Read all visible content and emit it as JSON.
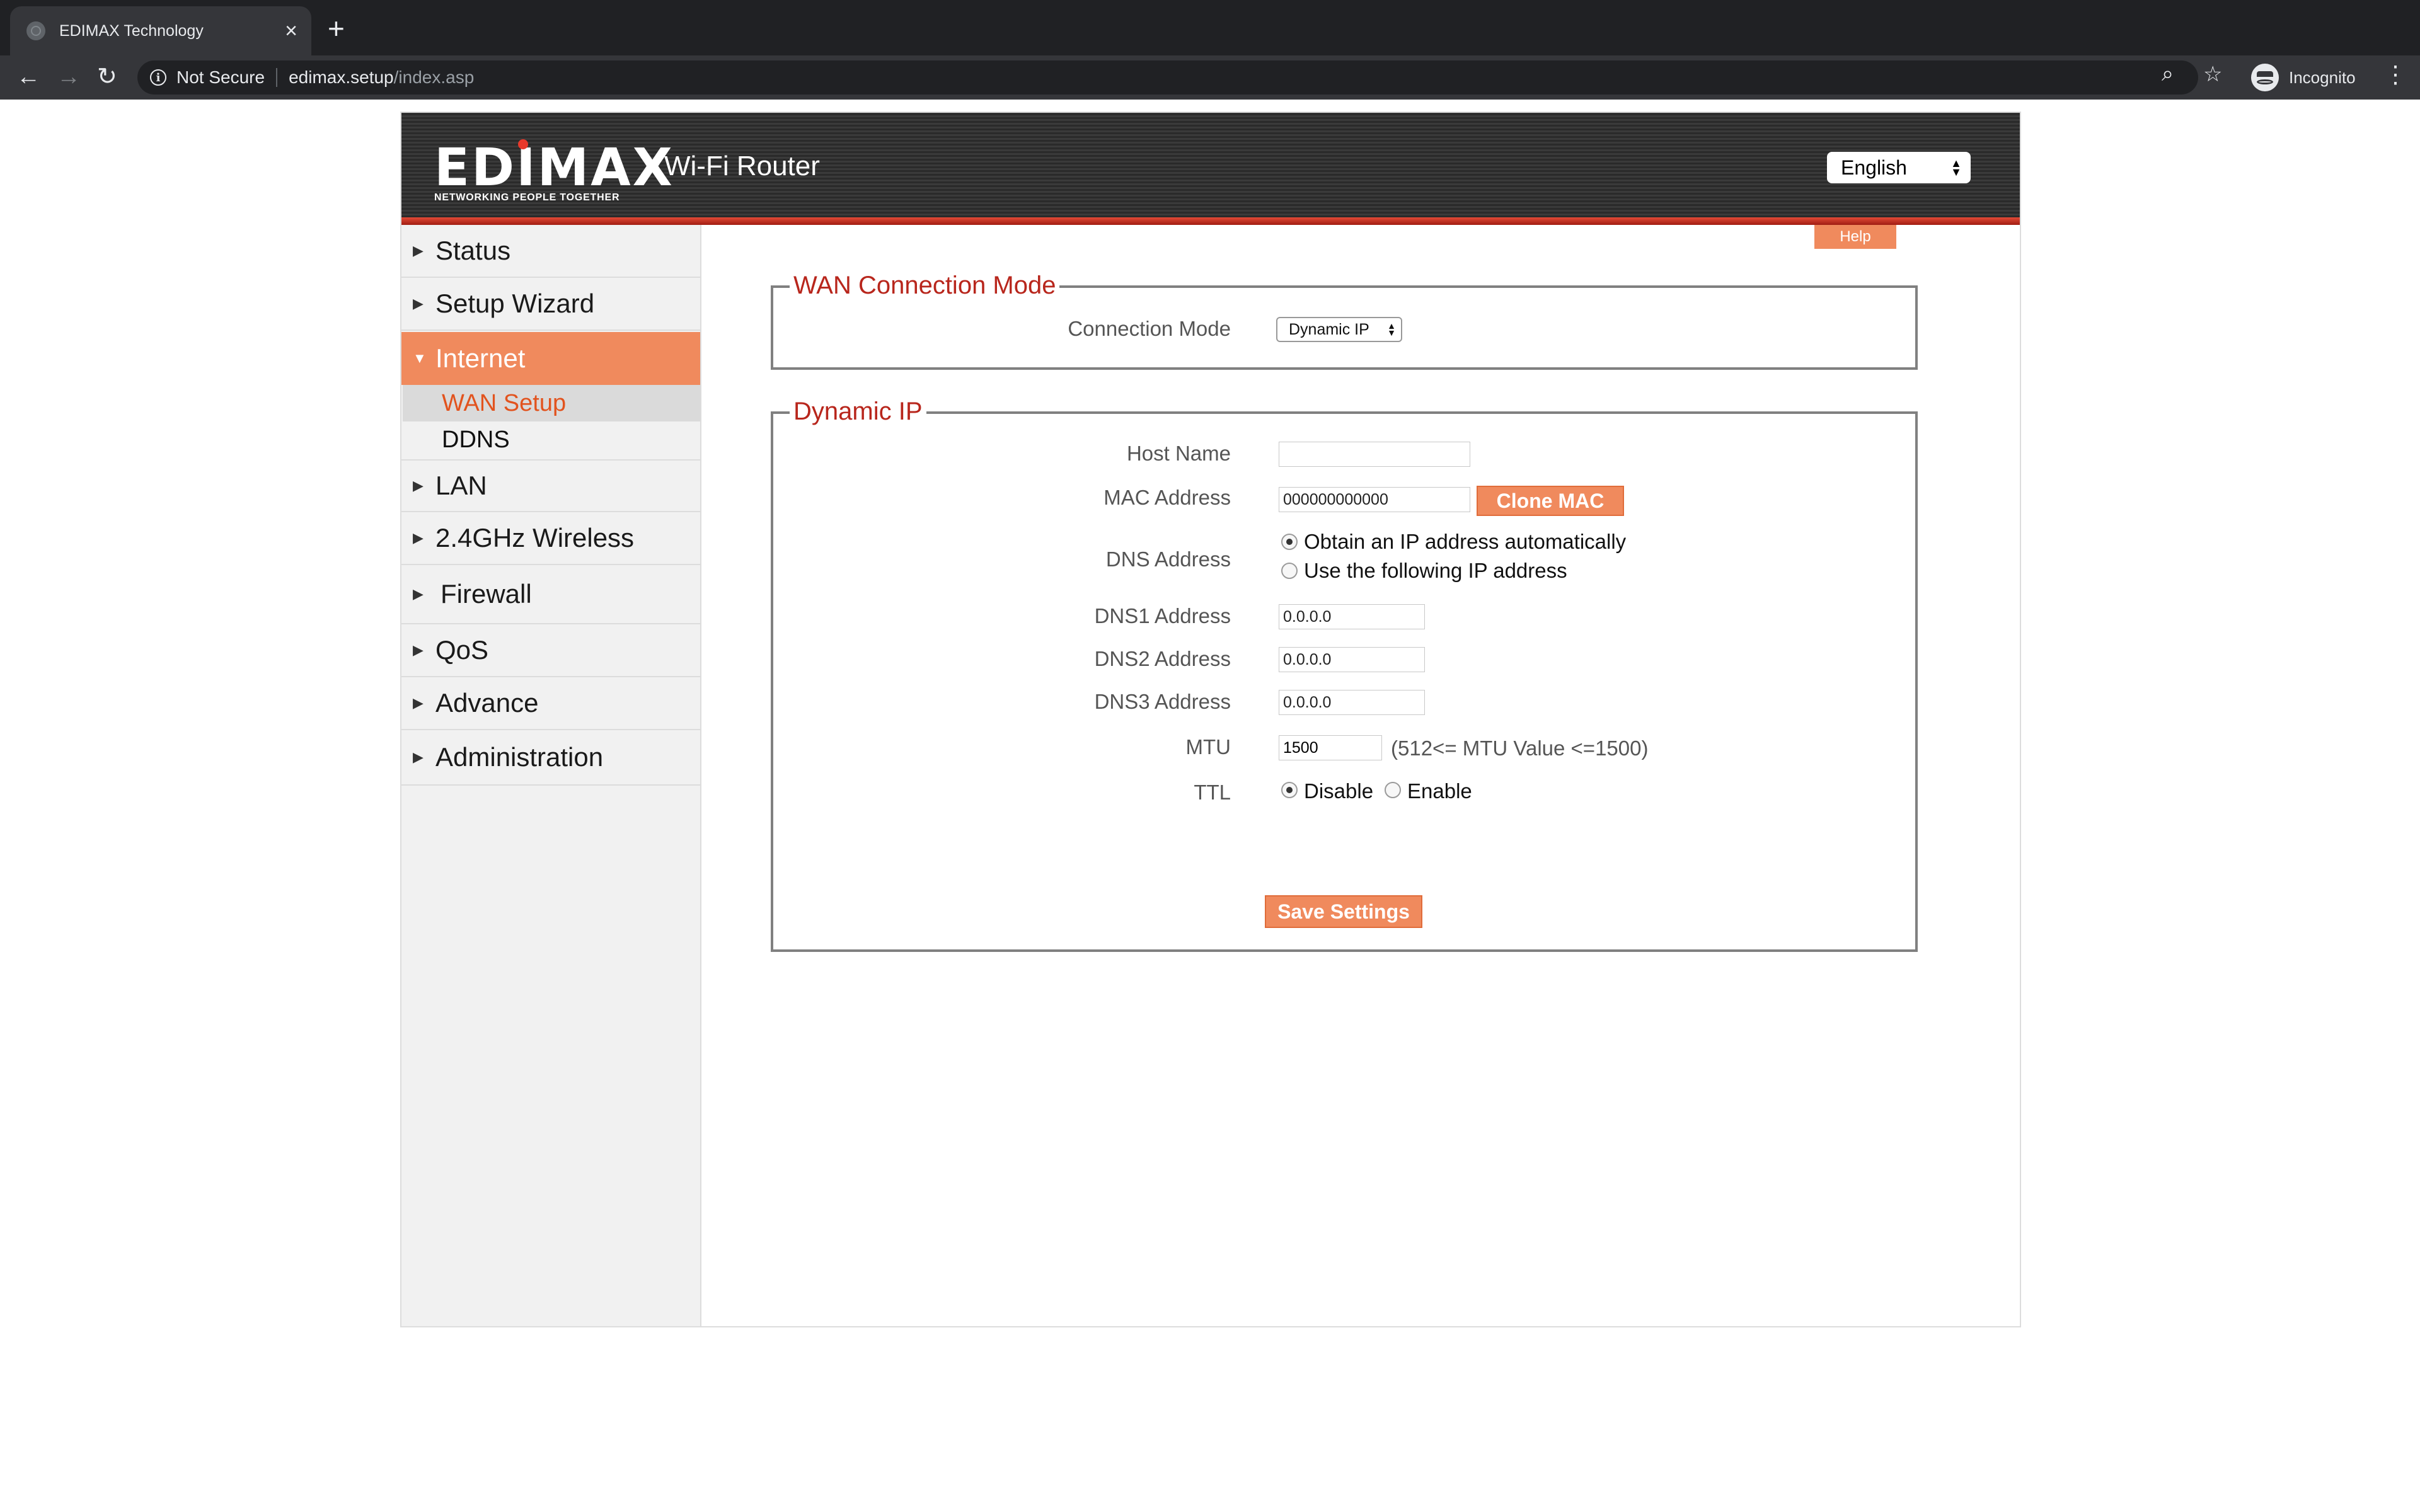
{
  "browser": {
    "tab_title": "EDIMAX Technology",
    "tab_close": "×",
    "new_tab": "+",
    "security_label": "Not Secure",
    "url_host": "edimax.setup",
    "url_path": "/index.asp",
    "profile_label": "Incognito"
  },
  "header": {
    "logo_text": "EDIMAX",
    "logo_tagline": "NETWORKING PEOPLE TOGETHER",
    "product_name": "Wi-Fi Router",
    "language": "English"
  },
  "sidebar": {
    "items": [
      {
        "label": "Status",
        "arrow": "▶"
      },
      {
        "label": "Setup Wizard",
        "arrow": "▶"
      },
      {
        "label": "Internet",
        "arrow": "▼"
      },
      {
        "label": "LAN",
        "arrow": "▶"
      },
      {
        "label": "2.4GHz Wireless",
        "arrow": "▶"
      },
      {
        "label": "Firewall",
        "arrow": "▶"
      },
      {
        "label": "QoS",
        "arrow": "▶"
      },
      {
        "label": "Advance",
        "arrow": "▶"
      },
      {
        "label": "Administration",
        "arrow": "▶"
      }
    ],
    "subitems": [
      {
        "label": "WAN Setup"
      },
      {
        "label": "DDNS"
      }
    ]
  },
  "main": {
    "help_label": "Help",
    "wan_mode": {
      "legend": "WAN Connection Mode",
      "connection_mode_label": "Connection Mode",
      "connection_mode_value": "Dynamic IP"
    },
    "dynamic_ip": {
      "legend": "Dynamic IP",
      "host_name_label": "Host Name",
      "host_name_value": "",
      "mac_label": "MAC Address",
      "mac_value": "000000000000",
      "clone_mac_label": "Clone MAC",
      "dns_label": "DNS  Address",
      "dns_option_auto": "Obtain an IP address automatically",
      "dns_option_manual": "Use the following IP address",
      "dns1_label": "DNS1  Address",
      "dns1_value": "0.0.0.0",
      "dns2_label": "DNS2  Address",
      "dns2_value": "0.0.0.0",
      "dns3_label": "DNS3  Address",
      "dns3_value": "0.0.0.0",
      "mtu_label": "MTU",
      "mtu_value": "1500",
      "mtu_note": "(512<= MTU  Value <=1500)",
      "ttl_label": "TTL",
      "ttl_disable": "Disable",
      "ttl_enable": "Enable",
      "save_label": "Save Settings"
    }
  },
  "colors": {
    "accent": "#f08a5d",
    "legend_red": "#b8261c",
    "header_dark": "#2a2a2a",
    "sidebar_bg": "#f1f1f1"
  }
}
